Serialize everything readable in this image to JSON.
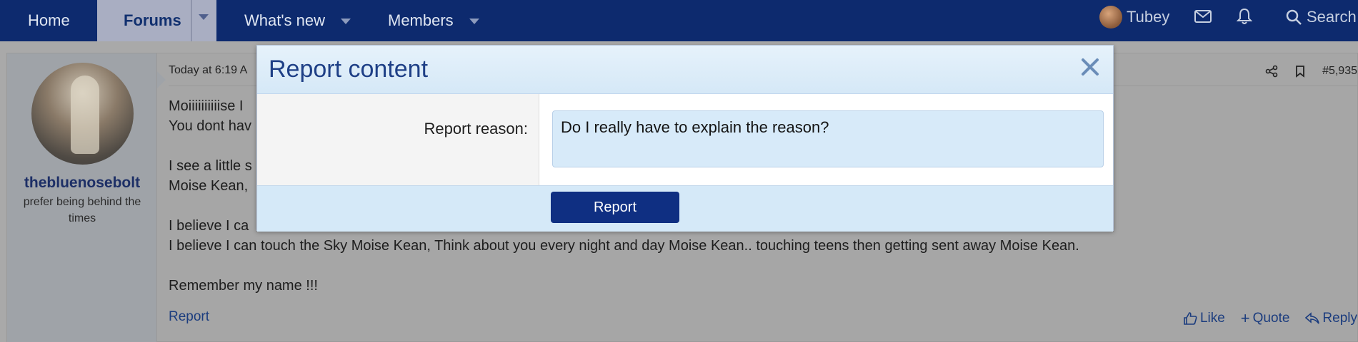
{
  "nav": {
    "home": "Home",
    "forums": "Forums",
    "whats_new": "What's new",
    "members": "Members",
    "user": "Tubey",
    "search": "Search"
  },
  "post": {
    "username": "thebluenosebolt",
    "user_title": "prefer being behind the times",
    "date": "Today at 6:19 A",
    "number": "#5,935",
    "lines": [
      "Moiiiiiiiiiise I",
      "You dont hav",
      "",
      "I see a little s",
      "Moise Kean,",
      "",
      "I believe I ca",
      "I believe I can touch the Sky Moise Kean, Think about you every night and day Moise Kean.. touching teens then getting sent away Moise Kean.",
      "",
      "Remember my name !!!"
    ],
    "report_link": "Report",
    "like": "Like",
    "quote": "Quote",
    "reply": "Reply"
  },
  "modal": {
    "title": "Report content",
    "reason_label": "Report reason:",
    "reason_value": "Do I really have to explain the reason?",
    "submit_label": "Report"
  },
  "icons": {
    "close": "close-icon",
    "share": "share-icon",
    "bookmark": "bookmark-icon",
    "mail": "mail-icon",
    "bell": "bell-icon",
    "search": "search-icon",
    "like": "thumbs-up-icon",
    "quote": "plus-icon",
    "reply": "reply-icon"
  },
  "colors": {
    "nav_bg": "#0d2a6e",
    "accent": "#0f2f82",
    "link": "#1b3c7e"
  }
}
